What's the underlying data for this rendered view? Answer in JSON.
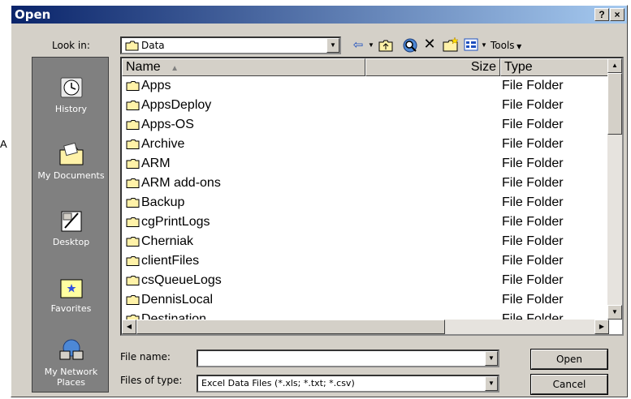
{
  "stray_char": "A",
  "dialog": {
    "title": "Open",
    "help_button": "?",
    "close_button": "×"
  },
  "toolbar": {
    "look_in_label": "Look in:",
    "look_in_value": "Data",
    "back_icon": "⇦",
    "up_icon": "up-folder-icon",
    "search_icon": "search-web-icon",
    "delete_icon": "✕",
    "new_folder_icon": "new-folder-icon",
    "views_icon": "views-icon",
    "tools_label": "Tools"
  },
  "places": [
    {
      "label_1": "History",
      "label_2": ""
    },
    {
      "label_1": "My Documents",
      "label_2": ""
    },
    {
      "label_1": "Desktop",
      "label_2": ""
    },
    {
      "label_1": "Favorites",
      "label_2": ""
    },
    {
      "label_1": "My Network",
      "label_2": "Places"
    }
  ],
  "columns": {
    "name": "Name",
    "size": "Size",
    "type": "Type"
  },
  "files": [
    {
      "name": "Apps",
      "type": "File Folder"
    },
    {
      "name": "AppsDeploy",
      "type": "File Folder"
    },
    {
      "name": "Apps-OS",
      "type": "File Folder"
    },
    {
      "name": "Archive",
      "type": "File Folder"
    },
    {
      "name": "ARM",
      "type": "File Folder"
    },
    {
      "name": "ARM add-ons",
      "type": "File Folder"
    },
    {
      "name": "Backup",
      "type": "File Folder"
    },
    {
      "name": "cgPrintLogs",
      "type": "File Folder"
    },
    {
      "name": "Cherniak",
      "type": "File Folder"
    },
    {
      "name": "clientFiles",
      "type": "File Folder"
    },
    {
      "name": "csQueueLogs",
      "type": "File Folder"
    },
    {
      "name": "DennisLocal",
      "type": "File Folder"
    },
    {
      "name": "Destination",
      "type": "File Folder"
    }
  ],
  "file_name": {
    "label": "File name:",
    "value": ""
  },
  "file_type": {
    "label": "Files of type:",
    "value": "Excel Data Files (*.xls; *.txt; *.csv)"
  },
  "buttons": {
    "open": "Open",
    "cancel": "Cancel"
  }
}
